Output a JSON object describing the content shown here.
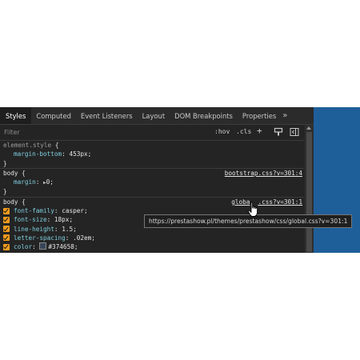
{
  "tabs": [
    "Styles",
    "Computed",
    "Event Listeners",
    "Layout",
    "DOM Breakpoints",
    "Properties"
  ],
  "tab_more": "»",
  "filter": {
    "placeholder": "Filter",
    "hov": ":hov",
    "cls": ".cls",
    "plus": "+"
  },
  "rules": [
    {
      "selector": "element.style",
      "open": "{",
      "close": "}",
      "source": "",
      "declarations": [
        {
          "prop": "margin-bottom",
          "value": "453px;"
        }
      ]
    },
    {
      "selector": "body",
      "open": "{",
      "close": "}",
      "source": "bootstrap.css?v=301:4",
      "declarations": [
        {
          "prop": "margin",
          "value": "0;"
        }
      ]
    },
    {
      "selector": "body",
      "open": "{",
      "source_pre": "globa",
      "source_post": ".css?v=301:1",
      "declarations": [
        {
          "prop": "font-family",
          "value": "casper;"
        },
        {
          "prop": "font-size",
          "value": "18px;"
        },
        {
          "prop": "line-height",
          "value": "1.5;"
        },
        {
          "prop": "letter-spacing",
          "value": ".02em;"
        },
        {
          "prop": "color",
          "value": "#374658;"
        }
      ]
    }
  ],
  "tooltip": "https://prestashow.pl/themes/prestashow/css/global.css?v=301:1",
  "colors": {
    "background": "#242424",
    "accent_blue": "#1f5f99",
    "checkbox": "#f29b1d",
    "property": "#7fcfe0",
    "swatch": "#374658"
  },
  "icons": [
    "plus-icon",
    "paint-icon",
    "sidebar-toggle-icon",
    "scroll-up-icon",
    "hand-cursor-icon"
  ]
}
